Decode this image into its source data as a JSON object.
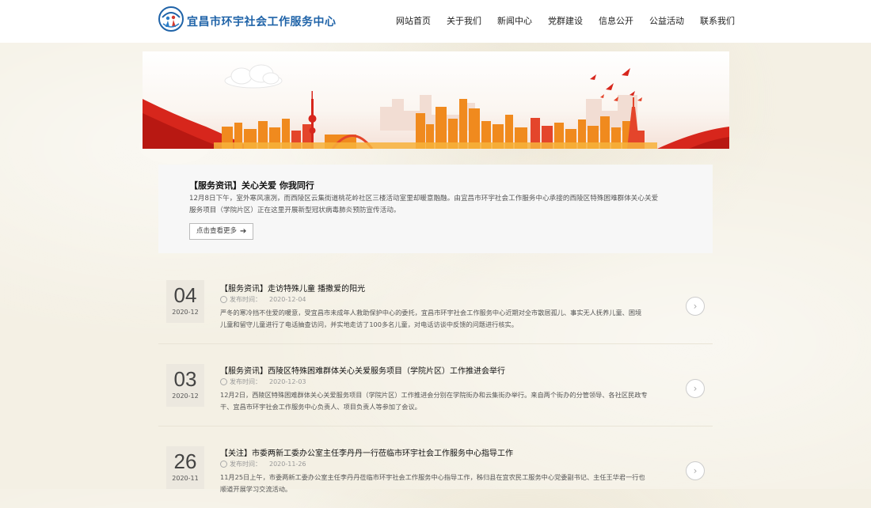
{
  "header": {
    "site_name": "宜昌市环宇社会工作服务中心",
    "nav": [
      "网站首页",
      "关于我们",
      "新闻中心",
      "党群建设",
      "信息公开",
      "公益活动",
      "联系我们"
    ]
  },
  "featured": {
    "title": "【服务资讯】关心关爱 你我同行",
    "text": "12月8日下午，室外寒风凛冽，而西陵区云集街道桃花岭社区三楼活动室里却暖意融融。由宜昌市环宇社会工作服务中心承接的西陵区特殊困难群体关心关爱服务项目（学院片区）正在这里开展新型冠状病毒肺炎预防宣传活动。",
    "more_label": "点击查看更多",
    "more_icon": "arrow-right-icon"
  },
  "news": [
    {
      "day": "04",
      "ym": "2020-12",
      "title": "【服务资讯】走访特殊儿童 播撒爱的阳光",
      "meta_label": "发布时间：",
      "date": "2020-12-04",
      "excerpt": "严冬的寒冷挡不住爱的暖意，受宜昌市未成年人救助保护中心的委托，宜昌市环宇社会工作服务中心近期对全市散居孤儿、事实无人抚养儿童、困境儿童和留守儿童进行了电话抽查访问，并实地走访了100多名儿童，对电话访谈中反馈的问题进行核实。"
    },
    {
      "day": "03",
      "ym": "2020-12",
      "title": "【服务资讯】西陵区特殊困难群体关心关爱服务项目（学院片区）工作推进会举行",
      "meta_label": "发布时间：",
      "date": "2020-12-03",
      "excerpt": "12月2日，西陵区特殊困难群体关心关爱服务项目（学院片区）工作推进会分别在学院街办和云集街办举行。来自两个街办的分管领导、各社区民政专干、宜昌市环宇社会工作服务中心负责人、项目负责人等参加了会议。"
    },
    {
      "day": "26",
      "ym": "2020-11",
      "title": "【关注】市委两新工委办公室主任李丹丹一行莅临市环宇社会工作服务中心指导工作",
      "meta_label": "发布时间：",
      "date": "2020-11-26",
      "excerpt": "11月25日上午，市委两新工委办公室主任李丹丹莅临市环宇社会工作服务中心指导工作，秭归县在宜农民工服务中心党委副书记、主任王华君一行也顺道开展学习交流活动。"
    }
  ],
  "colors": {
    "brand": "#1f63a8",
    "banner_red": "#d7261c",
    "banner_orange": "#f08a1e"
  }
}
